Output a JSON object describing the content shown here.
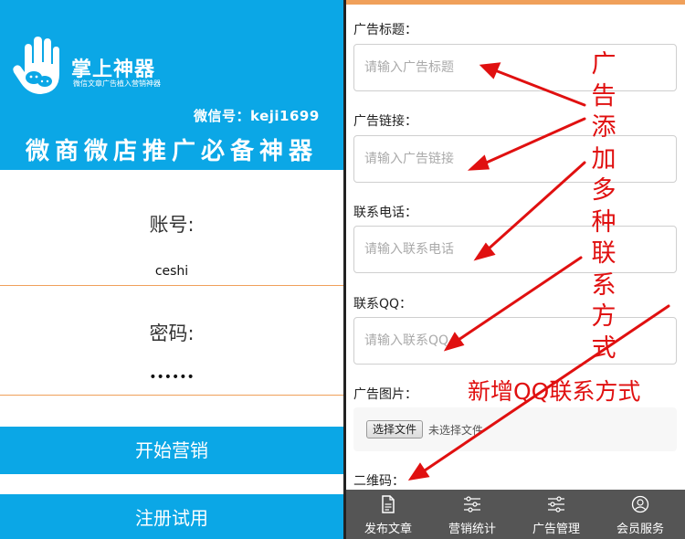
{
  "login_screen": {
    "brand_name": "掌上神器",
    "brand_tagline": "微信文章广告植入营销神器",
    "wechat_id": "微信号：keji1699",
    "slogan": "微商微店推广必备神器",
    "account_label": "账号:",
    "account_value": "ceshi",
    "password_label": "密码:",
    "password_value": "••••••",
    "start_button": "开始营销",
    "register_button": "注册试用",
    "accent_color": "#0ba7e6",
    "divider_color": "#f0a05a"
  },
  "ad_form": {
    "fields": [
      {
        "label": "广告标题：",
        "placeholder": "请输入广告标题"
      },
      {
        "label": "广告链接：",
        "placeholder": "请输入广告链接"
      },
      {
        "label": "联系电话：",
        "placeholder": "请输入联系电话"
      },
      {
        "label": "联系QQ：",
        "placeholder": "请输入联系QQ"
      }
    ],
    "image_label": "广告图片：",
    "file_button": "选择文件",
    "file_status": "未选择文件",
    "qrcode_label": "二维码："
  },
  "bottom_nav": {
    "items": [
      {
        "label": "发布文章",
        "icon": "document-icon"
      },
      {
        "label": "营销统计",
        "icon": "sliders-icon"
      },
      {
        "label": "广告管理",
        "icon": "sliders-icon"
      },
      {
        "label": "会员服务",
        "icon": "user-icon"
      }
    ]
  },
  "annotations": {
    "vertical_note": [
      "广",
      "告",
      "添",
      "加",
      "多",
      "种",
      "联",
      "系",
      "方",
      "式"
    ],
    "qq_note": "新增QQ联系方式",
    "color": "#e01010"
  }
}
